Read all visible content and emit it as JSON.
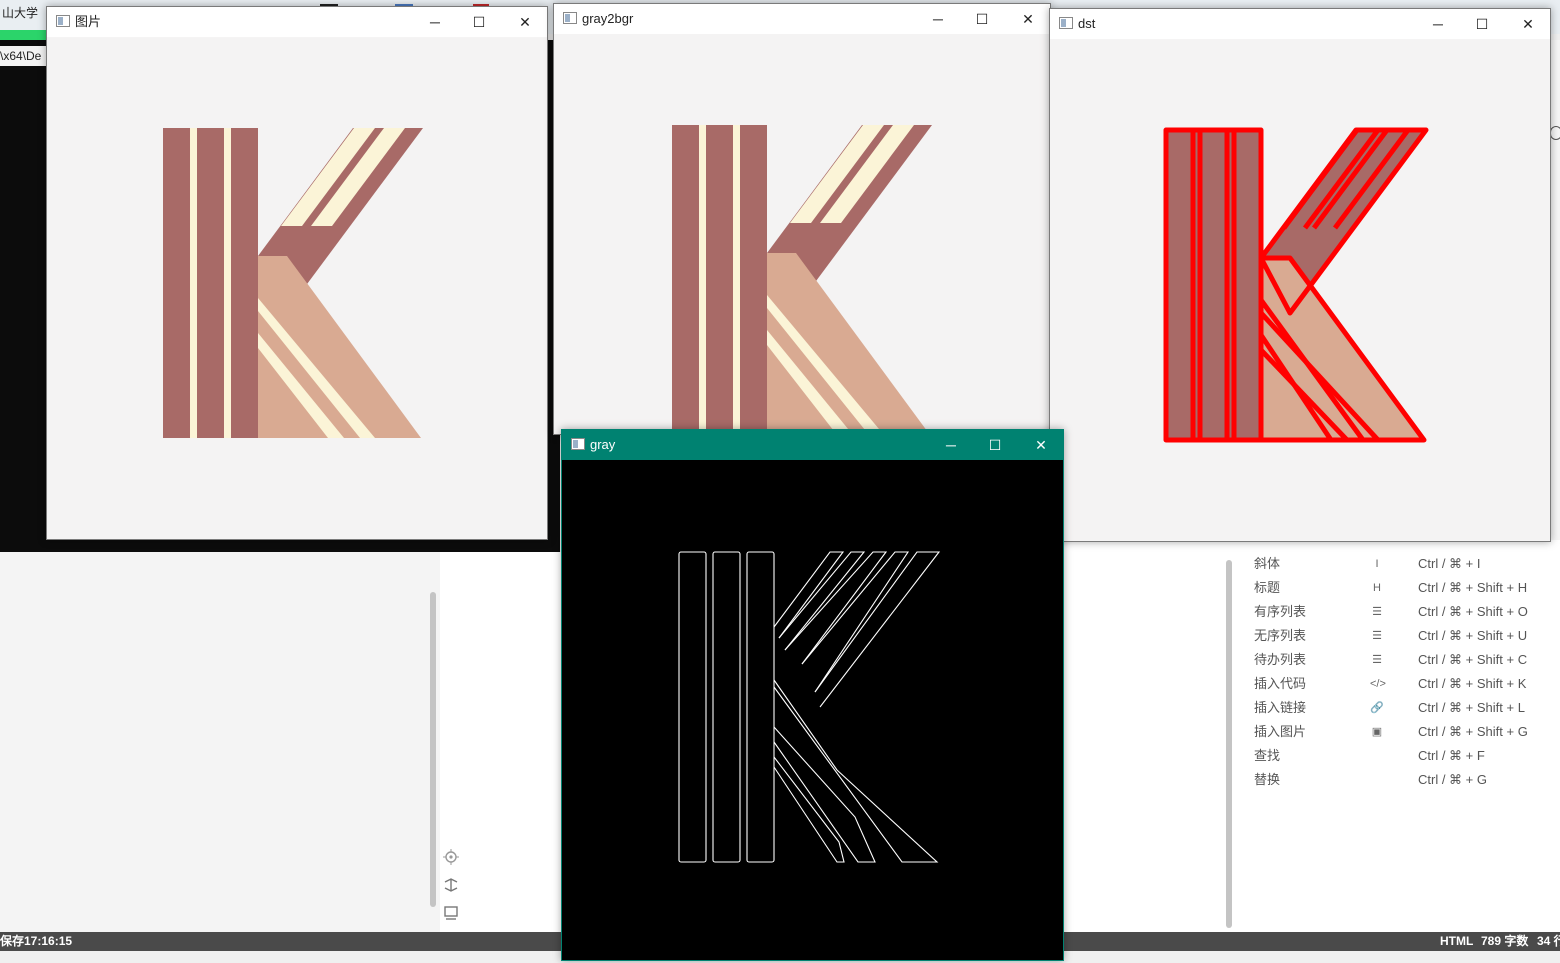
{
  "desktop": {
    "top_bar_text": "山大学",
    "console_path": "\\x64\\De"
  },
  "windows": [
    {
      "id": "picture",
      "title": "图片"
    },
    {
      "id": "gray2bgr",
      "title": "gray2bgr"
    },
    {
      "id": "dst",
      "title": "dst"
    },
    {
      "id": "gray",
      "title": "gray"
    }
  ],
  "window_controls": {
    "minimize": "─",
    "maximize": "☐",
    "close": "✕"
  },
  "image": {
    "colors": {
      "background": "#f4f3f3",
      "dark_bar": "#a86a67",
      "light_bar": "#d9aa92",
      "cream": "#fbf4d7",
      "contour": "#ff0000",
      "edges": "#ffffff",
      "edge_bg": "#000000"
    }
  },
  "shortcuts": [
    {
      "name": "斜体",
      "icon": "italic-icon",
      "glyph": "I",
      "keys": "Ctrl / ⌘ + I"
    },
    {
      "name": "标题",
      "icon": "heading-icon",
      "glyph": "H",
      "keys": "Ctrl / ⌘ + Shift + H"
    },
    {
      "name": "有序列表",
      "icon": "ordered-list-icon",
      "glyph": "☰",
      "keys": "Ctrl / ⌘ + Shift + O"
    },
    {
      "name": "无序列表",
      "icon": "unordered-list-icon",
      "glyph": "☰",
      "keys": "Ctrl / ⌘ + Shift + U"
    },
    {
      "name": "待办列表",
      "icon": "todo-list-icon",
      "glyph": "☰",
      "keys": "Ctrl / ⌘ + Shift + C"
    },
    {
      "name": "插入代码",
      "icon": "code-icon",
      "glyph": "</>",
      "keys": "Ctrl / ⌘ + Shift + K"
    },
    {
      "name": "插入链接",
      "icon": "link-icon",
      "glyph": "🔗",
      "keys": "Ctrl / ⌘ + Shift + L"
    },
    {
      "name": "插入图片",
      "icon": "image-icon",
      "glyph": "▣",
      "keys": "Ctrl / ⌘ + Shift + G"
    },
    {
      "name": "查找",
      "icon": "",
      "glyph": "",
      "keys": "Ctrl / ⌘ + F"
    },
    {
      "name": "替换",
      "icon": "",
      "glyph": "",
      "keys": "Ctrl / ⌘ + G"
    }
  ],
  "status_bar": {
    "saved": "保存17:16:15",
    "mode": "HTML",
    "word_count": "789 字数",
    "lines": "34 行"
  }
}
